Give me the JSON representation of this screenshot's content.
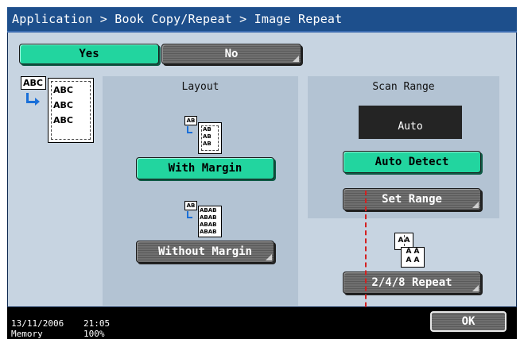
{
  "breadcrumb": "Application > Book Copy/Repeat > Image Repeat",
  "toggle": {
    "yes_label": "Yes",
    "no_label": "No"
  },
  "preview": {
    "top_label": "ABC",
    "rows": [
      "ABC",
      "ABC",
      "ABC"
    ]
  },
  "layout": {
    "title": "Layout",
    "with_margin_label": "With Margin",
    "without_margin_label": "Without Margin",
    "icon_text": "AB"
  },
  "scan_range": {
    "title": "Scan Range",
    "display_value": "Auto",
    "auto_detect_label": "Auto Detect",
    "set_range_label": "Set Range"
  },
  "repeat": {
    "label": "2/4/8 Repeat",
    "icon_text": "A"
  },
  "status": {
    "date": "13/11/2006",
    "time": "21:05",
    "memory_label": "Memory",
    "memory_value": "100%"
  },
  "ok_label": "OK",
  "colors": {
    "title_bg": "#1d4f8c",
    "panel_bg": "#c7d4e1",
    "selected": "#22d59f",
    "guide_line": "#d42020"
  }
}
